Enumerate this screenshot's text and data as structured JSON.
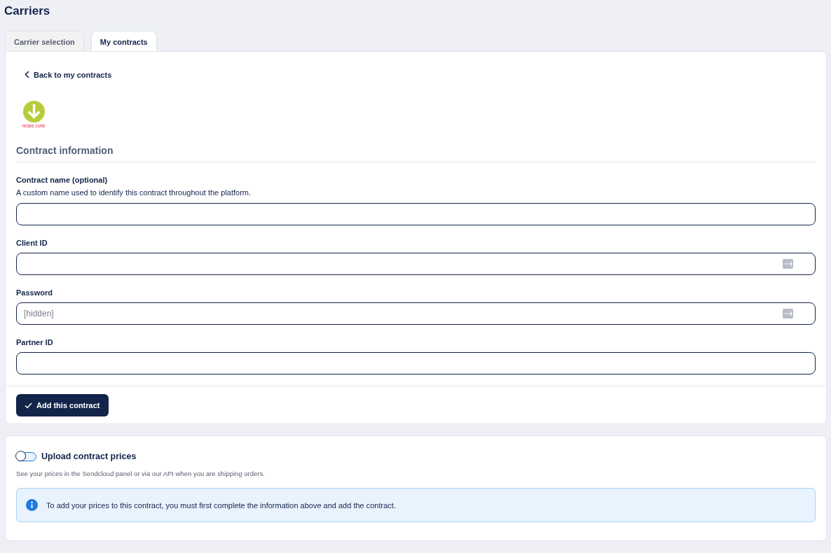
{
  "page": {
    "title": "Carriers"
  },
  "tabs": [
    {
      "label": "Carrier selection",
      "selected": false
    },
    {
      "label": "My contracts",
      "selected": true
    }
  ],
  "back_link": {
    "label": "Back to my contracts"
  },
  "carrier_logo": {
    "caption": "relais colis"
  },
  "section": {
    "title": "Contract information"
  },
  "fields": [
    {
      "kind": "text",
      "label": "Contract name (optional)",
      "help": "A custom name used to identify this contract throughout the platform."
    },
    {
      "kind": "secret",
      "label": "Client ID"
    },
    {
      "kind": "secret",
      "label": "Password",
      "placeholder": "[hidden]"
    },
    {
      "kind": "text",
      "label": "Partner ID"
    }
  ],
  "submit_button": {
    "label": "Add this contract"
  },
  "prices": {
    "toggle": {
      "label": "Upload contract prices",
      "on": false
    },
    "description": "See your prices in the Sendcloud panel or via our API when you are shipping orders.",
    "notice": "To add your prices to this contract, you must first complete the information above and add the contract."
  }
}
